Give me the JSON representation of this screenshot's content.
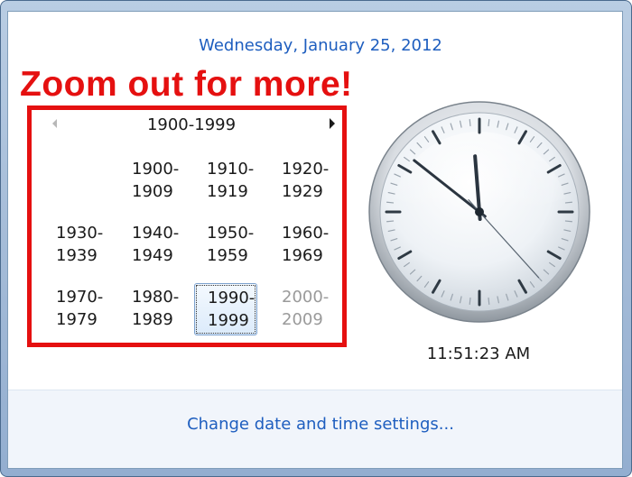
{
  "header": {
    "date_text": "Wednesday, January 25, 2012"
  },
  "annotation": {
    "text": "Zoom out for more!",
    "color": "#e51010"
  },
  "calendar": {
    "view": "century",
    "title": "1900-1999",
    "prev_label": "◄",
    "next_label": "►",
    "cells": [
      {
        "top": "",
        "bottom": "",
        "state": "empty"
      },
      {
        "top": "1900-",
        "bottom": "1909",
        "state": "normal"
      },
      {
        "top": "1910-",
        "bottom": "1919",
        "state": "normal"
      },
      {
        "top": "1920-",
        "bottom": "1929",
        "state": "normal"
      },
      {
        "top": "1930-",
        "bottom": "1939",
        "state": "normal"
      },
      {
        "top": "1940-",
        "bottom": "1949",
        "state": "normal"
      },
      {
        "top": "1950-",
        "bottom": "1959",
        "state": "normal"
      },
      {
        "top": "1960-",
        "bottom": "1969",
        "state": "normal"
      },
      {
        "top": "1970-",
        "bottom": "1979",
        "state": "normal"
      },
      {
        "top": "1980-",
        "bottom": "1989",
        "state": "normal"
      },
      {
        "top": "1990-",
        "bottom": "1999",
        "state": "selected"
      },
      {
        "top": "2000-",
        "bottom": "2009",
        "state": "dim"
      }
    ]
  },
  "clock": {
    "time_text": "11:51:23 AM",
    "hours": 11,
    "minutes": 51,
    "seconds": 23
  },
  "footer": {
    "link_text": "Change date and time settings..."
  },
  "colors": {
    "link": "#1e5ebf",
    "selection_border": "#7da2ce",
    "frame": "#a5bcd8"
  }
}
